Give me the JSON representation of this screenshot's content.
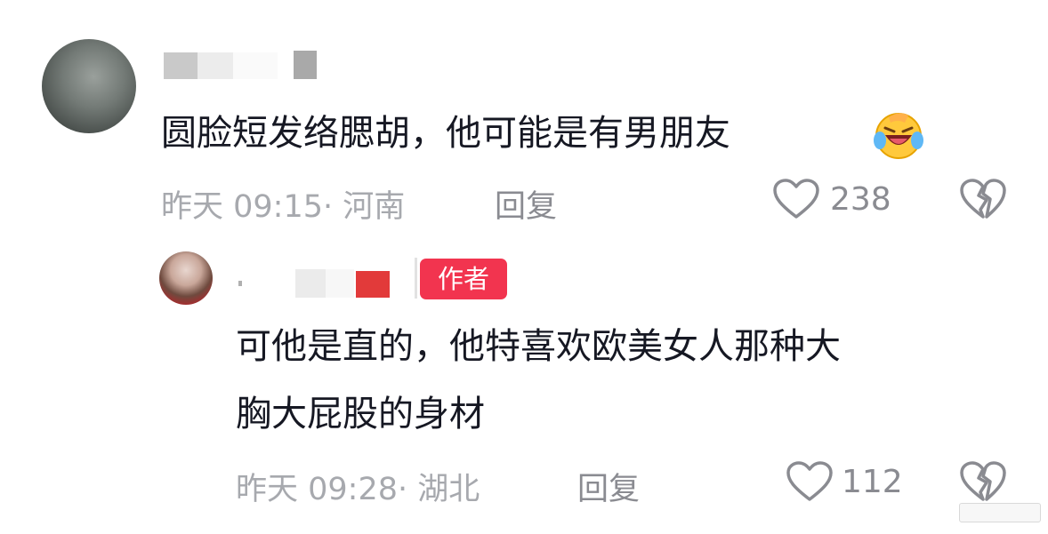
{
  "comments": [
    {
      "text": "圆脸短发络腮胡，他可能是有男朋友",
      "emoji": "laughing-crying-emoji",
      "time": "昨天 09:15· 河南",
      "reply_label": "回复",
      "like_count": "238"
    }
  ],
  "reply": {
    "badge": "作者",
    "text_lines": [
      "可他是直的，他特喜欢欧美女人那种大",
      "胸大屁股的身材"
    ],
    "time": "昨天 09:28· 湖北",
    "reply_label": "回复",
    "like_count": "112"
  },
  "colors": {
    "badge": "#f2344f",
    "meta": "#a7a9ae",
    "text": "#161823"
  }
}
